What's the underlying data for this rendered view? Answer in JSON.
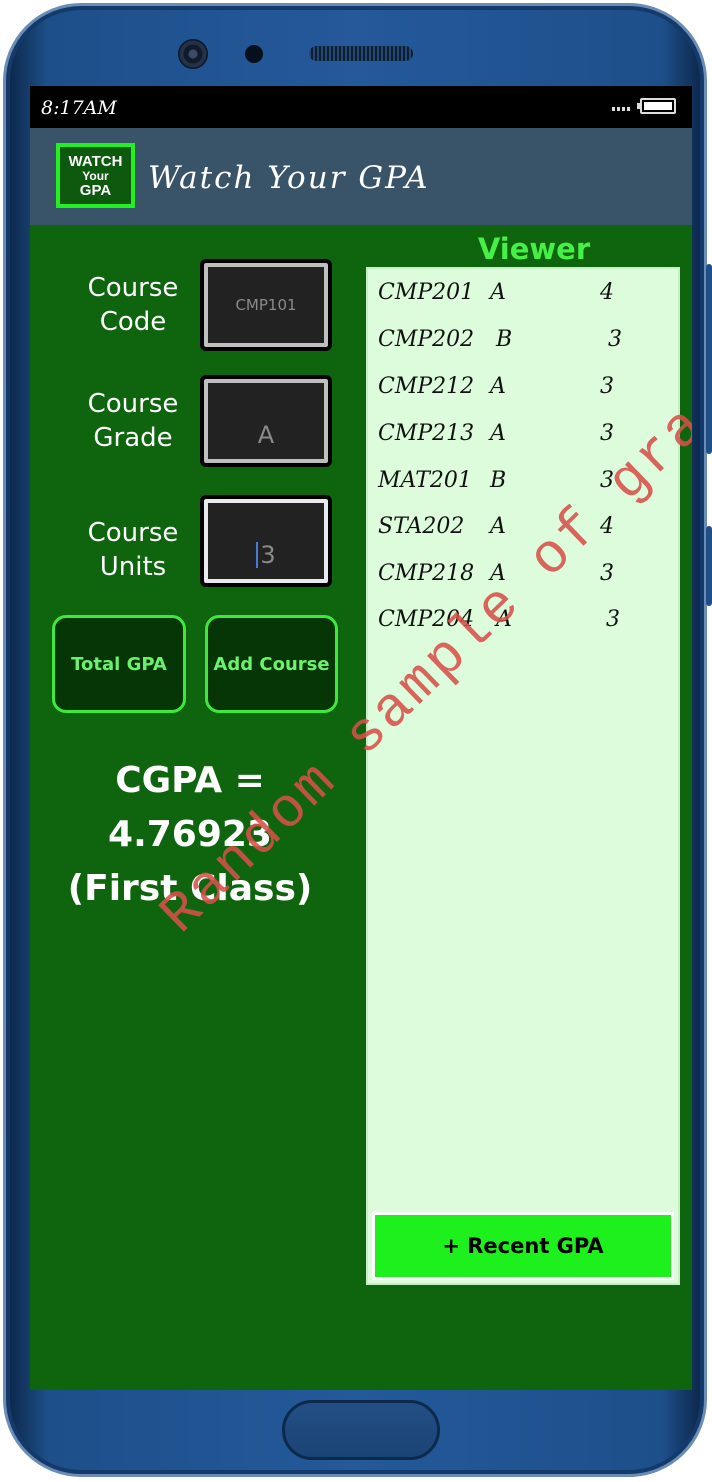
{
  "status": {
    "time": "8:17AM"
  },
  "app": {
    "logo": {
      "line1": "WATCH",
      "line2": "Your",
      "line3": "GPA"
    },
    "title": "Watch Your GPA"
  },
  "form": {
    "code_label_1": "Course",
    "code_label_2": "Code",
    "code_value": "CMP101",
    "grade_label_1": "Course",
    "grade_label_2": "Grade",
    "grade_value": "A",
    "units_label_1": "Course",
    "units_label_2": "Units",
    "units_value": "3"
  },
  "buttons": {
    "total_gpa": "Total GPA",
    "add_course": "Add Course",
    "recent_gpa": "+ Recent GPA"
  },
  "result": {
    "line1": "CGPA = 4.76923",
    "line2": "(First Class)"
  },
  "viewer": {
    "title": "Viewer",
    "rows": [
      {
        "code": "CMP201",
        "grade": "A",
        "units": "4"
      },
      {
        "code": "CMP202",
        "grade": "B",
        "units": "3"
      },
      {
        "code": "CMP212",
        "grade": "A",
        "units": "3"
      },
      {
        "code": "CMP213",
        "grade": "A",
        "units": "3"
      },
      {
        "code": "MAT201",
        "grade": "B",
        "units": "3"
      },
      {
        "code": "STA202",
        "grade": "A",
        "units": "4"
      },
      {
        "code": "CMP218",
        "grade": "A",
        "units": "3"
      },
      {
        "code": "CMP204",
        "grade": "A",
        "units": "3"
      }
    ]
  },
  "watermark": "Random sample of grades",
  "colors": {
    "screen_bg": "#0e650e",
    "appbar_bg": "#395369",
    "accent": "#23f023",
    "viewer_bg": "#dcfcdc"
  }
}
